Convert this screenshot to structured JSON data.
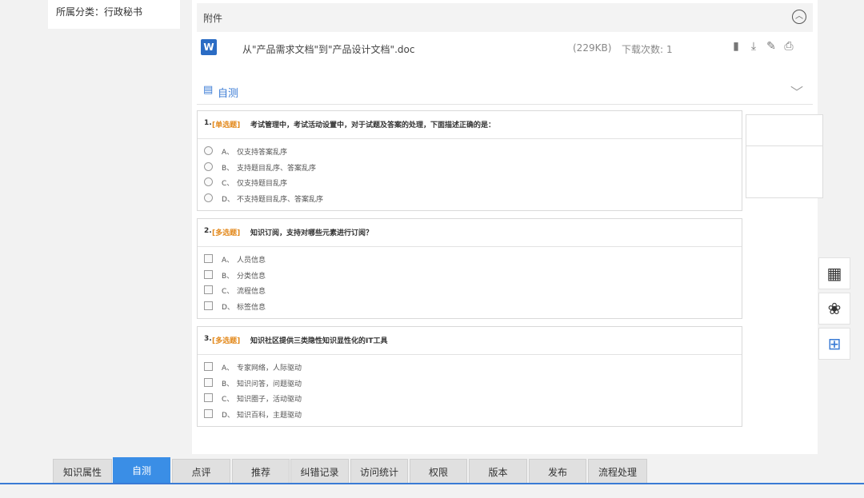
{
  "left_panel": {
    "category": "所属分类：行政秘书"
  },
  "attachment": {
    "title": "附件",
    "collapse_icon": "chevron-up-circle-icon",
    "file": {
      "icon": "W",
      "name": "从\"产品需求文档\"到\"产品设计文档\".doc",
      "size": "(229KB)",
      "downloads_label": "下载次数:",
      "downloads_count": "1"
    },
    "actions": [
      "book-icon",
      "download-icon",
      "edit-icon",
      "print-icon"
    ]
  },
  "selftest": {
    "label": "自测"
  },
  "questions": [
    {
      "num": "1.",
      "type": "[单选题]",
      "text": "考试管理中，考试活动设置中，对于试题及答案的处理，下面描述正确的是：",
      "input": "radio",
      "options": [
        {
          "letter": "A、",
          "text": "仅支持答案乱序"
        },
        {
          "letter": "B、",
          "text": "支持题目乱序、答案乱序"
        },
        {
          "letter": "C、",
          "text": "仅支持题目乱序"
        },
        {
          "letter": "D、",
          "text": "不支持题目乱序、答案乱序"
        }
      ]
    },
    {
      "num": "2.",
      "type": "[多选题]",
      "text": "知识订阅，支持对哪些元素进行订阅？",
      "input": "checkbox",
      "options": [
        {
          "letter": "A、",
          "text": "人员信息"
        },
        {
          "letter": "B、",
          "text": "分类信息"
        },
        {
          "letter": "C、",
          "text": "流程信息"
        },
        {
          "letter": "D、",
          "text": "标签信息"
        }
      ]
    },
    {
      "num": "3.",
      "type": "[多选题]",
      "text": "知识社区提供三类隐性知识显性化的IT工具",
      "input": "checkbox",
      "options": [
        {
          "letter": "A、",
          "text": "专家网络，人际驱动"
        },
        {
          "letter": "B、",
          "text": "知识问答，问题驱动"
        },
        {
          "letter": "C、",
          "text": "知识圈子，活动驱动"
        },
        {
          "letter": "D、",
          "text": "知识百科，主题驱动"
        }
      ]
    }
  ],
  "float_tools": [
    "qr-code-icon",
    "tulip-icon",
    "apps-grid-icon"
  ],
  "tabs": [
    {
      "label": "知识属性",
      "active": false
    },
    {
      "label": "自测",
      "active": true
    },
    {
      "label": "点评",
      "active": false
    },
    {
      "label": "推荐",
      "active": false
    },
    {
      "label": "纠错记录",
      "active": false
    },
    {
      "label": "访问统计",
      "active": false
    },
    {
      "label": "权限",
      "active": false
    },
    {
      "label": "版本",
      "active": false
    },
    {
      "label": "发布",
      "active": false
    },
    {
      "label": "流程处理",
      "active": false
    }
  ],
  "colors": {
    "accent": "#3a8ee6",
    "type_tag": "#e38a1e",
    "word": "#2b6cc4"
  }
}
